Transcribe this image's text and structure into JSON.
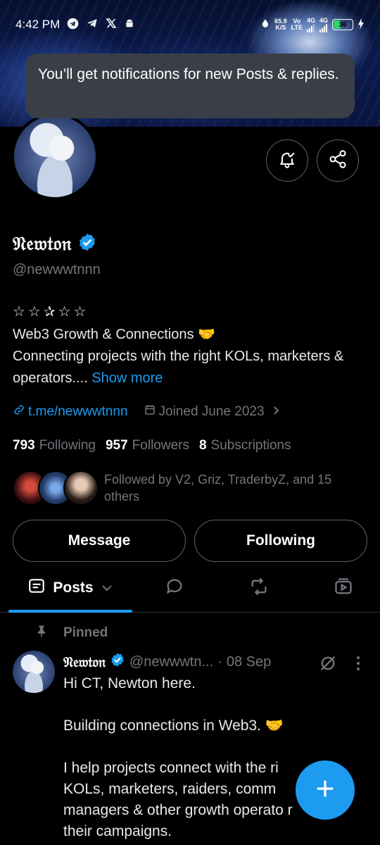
{
  "status_bar": {
    "time": "4:42 PM",
    "speed_value": "65.9",
    "speed_unit": "K/S",
    "net1_top": "Vo",
    "net1_bottom": "LTE",
    "net2": "4G",
    "net3": "4G",
    "battery": "36",
    "battery_level": 0.36
  },
  "toast": {
    "message": "You’ll get notifications for new Posts & replies."
  },
  "profile": {
    "display_name": "𝔑𝔢𝔴𝔱𝔬𝔫",
    "handle": "@newwwtnnn",
    "stars": "☆☆✰☆☆",
    "bio_line1": "Web3 Growth & Connections 🤝",
    "bio_line2": "Connecting projects with the right KOLs, marketers & operators....",
    "show_more": "Show more",
    "link": "t.me/newwwtnnn",
    "joined": "Joined June 2023",
    "following_count": "793",
    "following_label": "Following",
    "followers_count": "957",
    "followers_label": "Followers",
    "subs_count": "8",
    "subs_label": "Subscriptions",
    "followed_by": "Followed by V2, Griz, TraderbyZ, and 15 others"
  },
  "actions": {
    "message": "Message",
    "following": "Following"
  },
  "tabs": {
    "posts": "Posts"
  },
  "post": {
    "pinned_label": "Pinned",
    "author_name": "𝔑𝔢𝔴𝔱𝔬𝔫",
    "author_handle": "@newwwtn...",
    "separator": "·",
    "date": "08 Sep",
    "body": "Hi CT, Newton here.\n\nBuilding connections in Web3. 🤝\n\nI help projects connect with the ri\nKOLs, marketers, raiders, comm\nmanagers & other growth operato    r\ntheir campaigns."
  },
  "colors": {
    "accent": "#1d9bf0",
    "muted": "#71767b",
    "border": "#536471",
    "toast_bg": "#3a3f47",
    "battery_green": "#2dd36f"
  },
  "icons": [
    "telegram-icon",
    "send-icon",
    "x-logo-icon",
    "android-icon",
    "drop-icon",
    "bell-check-icon",
    "share-icon",
    "verified-badge-icon",
    "link-icon",
    "calendar-icon",
    "chevron-right-icon",
    "posts-icon",
    "chevron-down-icon",
    "reply-icon",
    "repost-icon",
    "media-icon",
    "pin-icon",
    "grok-icon",
    "more-icon",
    "compose-plus-icon",
    "lightning-icon"
  ]
}
